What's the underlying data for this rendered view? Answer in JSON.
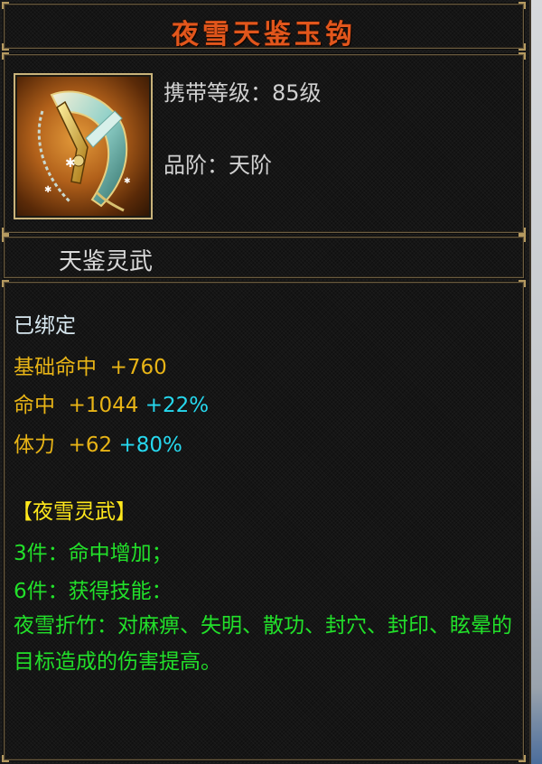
{
  "item": {
    "name": "夜雪天鉴玉钩",
    "level_label": "携带等级：",
    "level_value": "85级",
    "grade_label": "品阶：",
    "grade_value": "天阶",
    "category": "天鉴灵武"
  },
  "stats": {
    "bound": "已绑定",
    "base_hit": {
      "label": "基础命中",
      "value": "+760"
    },
    "hit": {
      "label": "命中",
      "value": "+1044",
      "bonus": "+22%"
    },
    "stamina": {
      "label": "体力",
      "value": "+62",
      "bonus": "+80%"
    }
  },
  "set": {
    "name": "【夜雪灵武】",
    "piece3": "3件：命中增加；",
    "piece6": "6件：获得技能：",
    "skill_desc": "夜雪折竹：对麻痹、失明、散功、封穴、封印、眩晕的目标造成的伤害提高。"
  },
  "colors": {
    "title": "#e2561c",
    "gold": "#e8b416",
    "cyan": "#26d8ee",
    "green": "#22e02a",
    "yellow": "#ffe81c"
  }
}
